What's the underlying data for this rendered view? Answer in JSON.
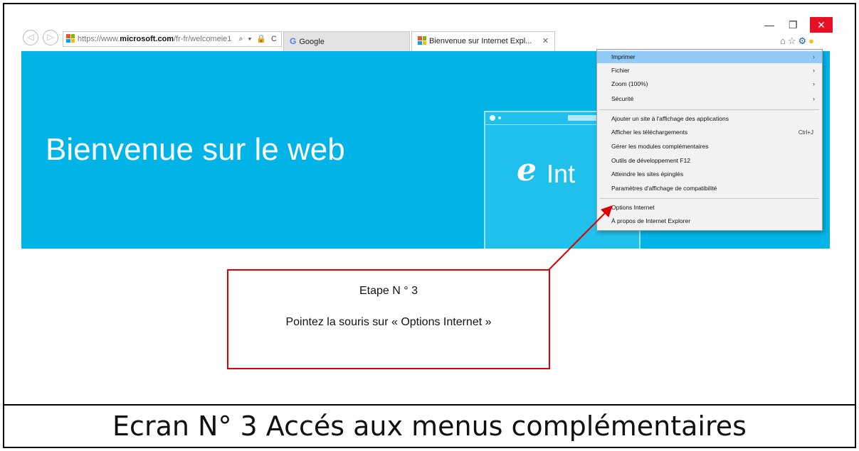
{
  "browser": {
    "back_icon": "back-arrow-icon",
    "forward_icon": "forward-arrow-icon",
    "address": {
      "url_prefix": "https://www.",
      "url_domain": "microsoft.com",
      "url_path": "/fr-fr/welcomeie1",
      "icons": "⌕ ▾ 🔒 C"
    },
    "tabs": [
      {
        "label": "Google"
      },
      {
        "label": "Bienvenue sur Internet Expl...",
        "close": "✕"
      }
    ],
    "window_controls": {
      "minimize": "—",
      "restore": "❐",
      "close": "✕"
    },
    "toolbar_icons": [
      "home-icon",
      "star-icon",
      "gear-icon",
      "smiley-icon"
    ]
  },
  "page": {
    "banner_title": "Bienvenue sur le web",
    "ie_logo_letter": "e",
    "ie_logo_text": "Int"
  },
  "menu": {
    "items": [
      {
        "label": "Imprimer",
        "arrow": "›",
        "highlight": true
      },
      {
        "label": "Fichier",
        "arrow": "›"
      },
      {
        "label": "Zoom (100%)",
        "arrow": "›"
      },
      {
        "label": "Sécurité",
        "arrow": "›"
      },
      {
        "label": "Ajouter un site à l'affichage des applications"
      },
      {
        "label": "Afficher les téléchargements",
        "shortcut": "Ctrl+J"
      },
      {
        "label": "Gérer les modules complémentaires"
      },
      {
        "label": "Outils de développement F12"
      },
      {
        "label": "Atteindre les sites épinglés"
      },
      {
        "label": "Paramètres d'affichage de compatibilité"
      },
      {
        "label": "Options Internet"
      },
      {
        "label": "À propos de Internet Explorer"
      }
    ]
  },
  "annotation": {
    "step": "Etape N ° 3",
    "text": "Pointez la souris sur « Options Internet »",
    "color": "#e00000"
  },
  "caption": "Ecran N° 3 Accés aux menus complémentaires",
  "colors": {
    "banner": "#00b4e8",
    "menu_highlight": "#91c9f7",
    "close_button": "#e81123"
  }
}
